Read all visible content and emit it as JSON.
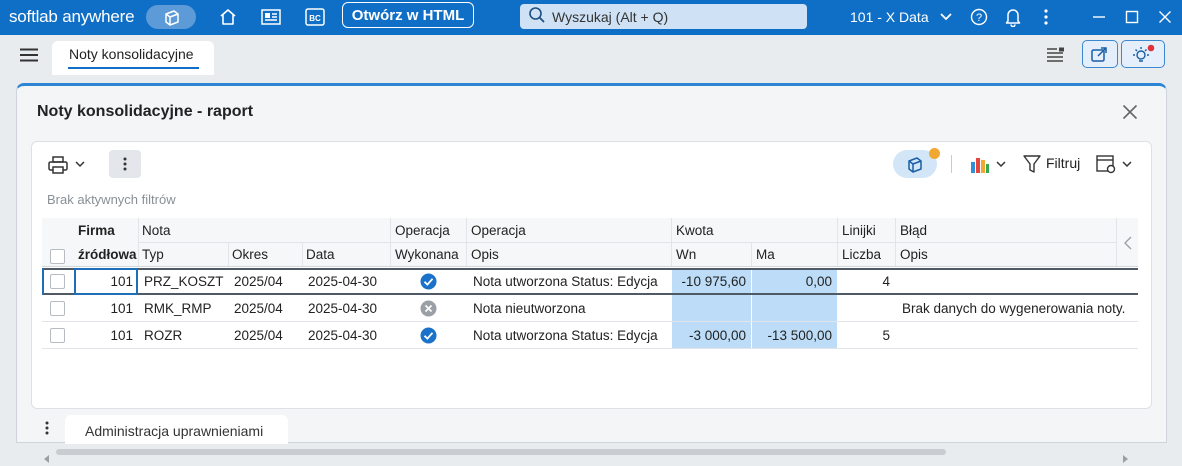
{
  "app": {
    "brand": "softlab anywhere",
    "open_html": "Otwórz w HTML",
    "search_placeholder": "Wyszukaj (Alt + Q)",
    "database": "101 - X Data"
  },
  "tabs": {
    "main": "Noty konsolidacyjne",
    "bottom": "Administracja uprawnieniami"
  },
  "panel": {
    "title": "Noty konsolidacyjne - raport",
    "filters_text": "Brak aktywnych filtrów",
    "filter_label": "Filtruj"
  },
  "grid": {
    "group_headers": [
      "Firma",
      "Nota",
      "Operacja",
      "Operacja",
      "Kwota",
      "Linijki",
      "Błąd"
    ],
    "sub_headers": [
      "źródłowa",
      "Typ",
      "Okres",
      "Data",
      "Wykonana",
      "Opis",
      "Wn",
      "Ma",
      "Liczba",
      "Opis"
    ],
    "rows": [
      {
        "firma": "101",
        "typ": "PRZ_KOSZT",
        "okres": "2025/04",
        "data": "2025-04-30",
        "wykonana": "ok",
        "opis": "Nota utworzona Status: Edycja",
        "wn": "-10 975,60",
        "ma": "0,00",
        "liczba": "4",
        "blad": ""
      },
      {
        "firma": "101",
        "typ": "RMK_RMP",
        "okres": "2025/04",
        "data": "2025-04-30",
        "wykonana": "error",
        "opis": "Nota nieutworzona",
        "wn": "",
        "ma": "",
        "liczba": "",
        "blad": "Brak danych do wygenerowania noty."
      },
      {
        "firma": "101",
        "typ": "ROZR",
        "okres": "2025/04",
        "data": "2025-04-30",
        "wykonana": "ok",
        "opis": "Nota utworzona Status: Edycja",
        "wn": "-3 000,00",
        "ma": "-13 500,00",
        "liczba": "5",
        "blad": ""
      }
    ]
  },
  "colors": {
    "accent": "#0f6fc6",
    "amount_cell": "#bcdcf7",
    "status_ok": "#1a73c8",
    "status_error": "#9aa0a6",
    "notify_dot": "#e0323c",
    "badge_dot": "#f0a832"
  },
  "icons": {
    "titlebar": [
      "cube-icon",
      "home-icon",
      "news-icon",
      "bc-icon",
      "search-icon",
      "chevron-down-icon",
      "help-icon",
      "bell-icon",
      "more-vertical-icon",
      "minimize-icon",
      "maximize-icon",
      "close-icon"
    ],
    "toolbar": [
      "print-icon",
      "chevron-down-icon",
      "more-vertical-icon",
      "cube-icon",
      "bar-chart-icon",
      "filter-icon",
      "settings-icon"
    ]
  }
}
